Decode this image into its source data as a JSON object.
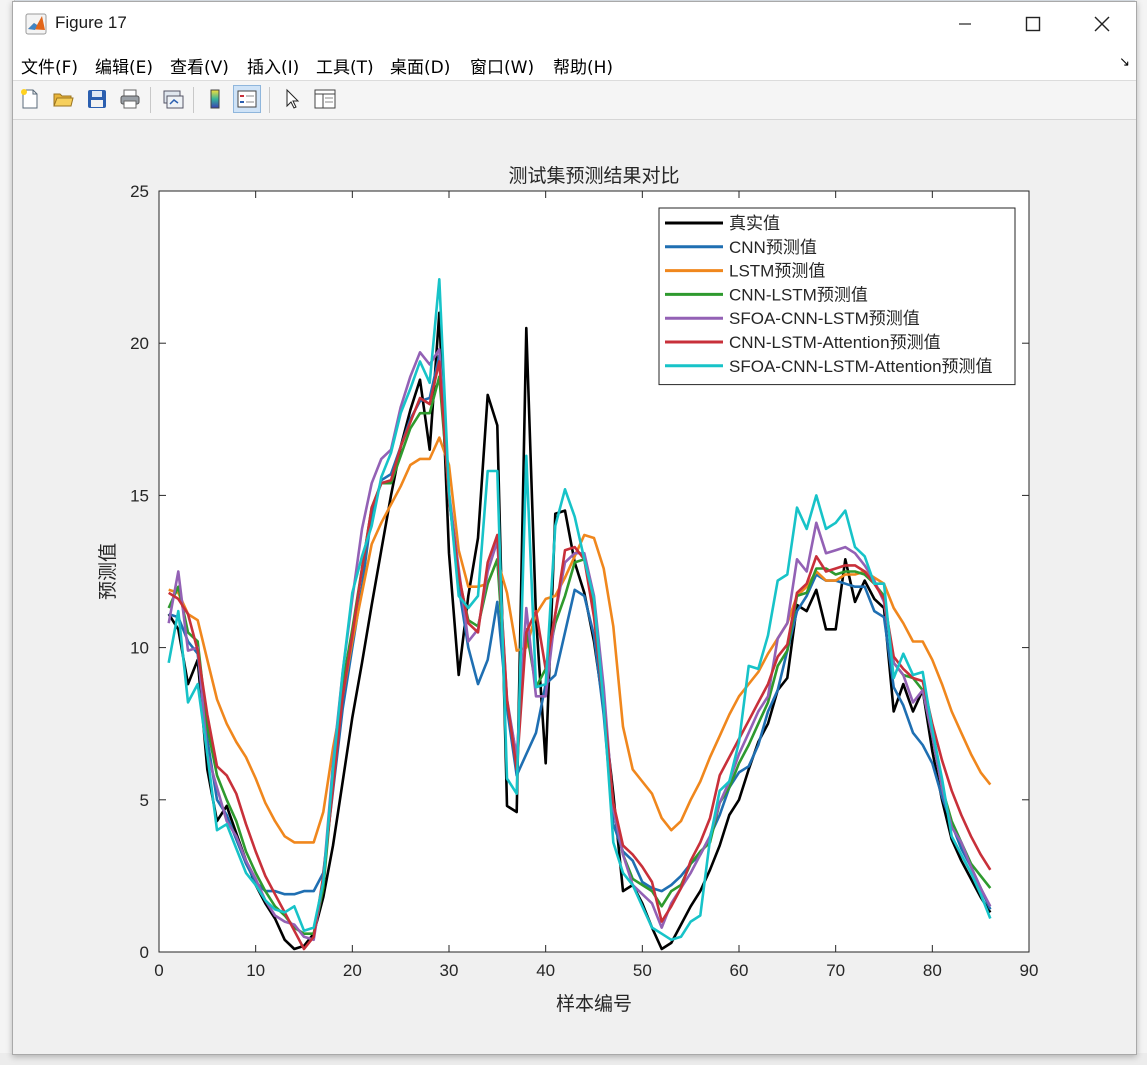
{
  "window": {
    "title": "Figure 17",
    "minimize_symbol": "—",
    "maximize_symbol": "☐",
    "close_symbol": "✕"
  },
  "menu": {
    "items": [
      "文件(F)",
      "编辑(E)",
      "查看(V)",
      "插入(I)",
      "工具(T)",
      "桌面(D)",
      "窗口(W)",
      "帮助(H)"
    ],
    "dock_arrow": "↘"
  },
  "toolbar": {
    "icons": [
      "new-figure-icon",
      "open-file-icon",
      "save-icon",
      "print-icon",
      "link-plot-icon",
      "colorbar-icon",
      "legend-icon",
      "pointer-icon",
      "property-inspector-icon"
    ]
  },
  "chart_data": {
    "type": "line",
    "title": "测试集预测结果对比",
    "xlabel": "样本编号",
    "ylabel": "预测值",
    "xlim": [
      0,
      90
    ],
    "ylim": [
      0,
      25
    ],
    "xticks": [
      0,
      10,
      20,
      30,
      40,
      50,
      60,
      70,
      80,
      90
    ],
    "yticks": [
      0,
      5,
      10,
      15,
      20,
      25
    ],
    "legend_position": "top-right",
    "grid": false,
    "x": [
      1,
      2,
      3,
      4,
      5,
      6,
      7,
      8,
      9,
      10,
      11,
      12,
      13,
      14,
      15,
      16,
      17,
      18,
      19,
      20,
      21,
      22,
      23,
      24,
      25,
      26,
      27,
      28,
      29,
      30,
      31,
      32,
      33,
      34,
      35,
      36,
      37,
      38,
      39,
      40,
      41,
      42,
      43,
      44,
      45,
      46,
      47,
      48,
      49,
      50,
      51,
      52,
      53,
      54,
      55,
      56,
      57,
      58,
      59,
      60,
      61,
      62,
      63,
      64,
      65,
      66,
      67,
      68,
      69,
      70,
      71,
      72,
      73,
      74,
      75,
      76,
      77,
      78,
      79,
      80,
      81,
      82,
      83,
      84,
      85,
      86
    ],
    "series": [
      {
        "name": "真实值",
        "color": "#000000",
        "values": [
          11.1,
          10.6,
          8.8,
          9.6,
          6.0,
          4.3,
          4.8,
          3.9,
          3.0,
          2.2,
          1.6,
          1.1,
          0.4,
          0.1,
          0.2,
          0.6,
          1.8,
          3.5,
          5.6,
          7.7,
          9.5,
          11.4,
          13.2,
          15.0,
          16.6,
          17.8,
          18.8,
          16.5,
          21.0,
          13.1,
          9.1,
          11.7,
          13.6,
          18.3,
          17.3,
          4.8,
          4.6,
          20.5,
          11.0,
          6.2,
          14.4,
          14.5,
          12.8,
          11.8,
          10.2,
          8.0,
          5.2,
          2.0,
          2.2,
          1.6,
          0.8,
          0.1,
          0.3,
          0.9,
          1.5,
          2.0,
          2.7,
          3.5,
          4.5,
          5.0,
          6.0,
          6.9,
          7.5,
          8.6,
          9.0,
          11.4,
          11.2,
          11.9,
          10.6,
          10.6,
          12.9,
          11.5,
          12.2,
          11.6,
          11.3,
          7.9,
          8.8,
          7.9,
          8.6,
          6.6,
          5.0,
          3.7,
          3.0,
          2.4,
          1.8,
          1.3
        ]
      },
      {
        "name": "CNN预测值",
        "color": "#1f6fb2",
        "values": [
          11.1,
          11.0,
          10.2,
          9.8,
          7.0,
          5.0,
          4.5,
          3.7,
          2.9,
          2.3,
          2.0,
          2.0,
          1.9,
          1.9,
          2.0,
          2.0,
          2.6,
          5.3,
          8.0,
          10.0,
          12.0,
          14.4,
          15.5,
          15.7,
          16.6,
          17.5,
          18.1,
          18.2,
          19.6,
          15.0,
          12.0,
          10.0,
          8.8,
          9.6,
          11.5,
          8.0,
          5.8,
          6.5,
          7.2,
          8.8,
          9.1,
          10.5,
          11.9,
          11.7,
          10.4,
          7.8,
          4.2,
          3.3,
          3.0,
          2.3,
          2.1,
          2.0,
          2.2,
          2.5,
          2.9,
          3.2,
          3.8,
          4.5,
          5.4,
          5.9,
          6.1,
          6.8,
          7.9,
          8.6,
          9.9,
          11.2,
          11.7,
          12.4,
          12.2,
          12.2,
          12.1,
          12.0,
          12.0,
          11.2,
          11.0,
          8.7,
          8.1,
          7.2,
          6.8,
          6.2,
          5.1,
          4.2,
          3.4,
          2.8,
          2.1,
          1.4
        ]
      },
      {
        "name": "LSTM预测值",
        "color": "#f0871d",
        "values": [
          11.9,
          11.8,
          11.1,
          10.9,
          9.6,
          8.3,
          7.5,
          6.9,
          6.4,
          5.7,
          4.9,
          4.3,
          3.8,
          3.6,
          3.6,
          3.6,
          4.6,
          6.7,
          8.4,
          10.2,
          11.8,
          13.4,
          14.1,
          14.7,
          15.3,
          16.0,
          16.2,
          16.2,
          16.9,
          16.0,
          13.2,
          12.0,
          12.0,
          12.1,
          12.9,
          11.8,
          9.9,
          10.0,
          11.1,
          11.6,
          11.7,
          12.3,
          13.0,
          13.7,
          13.6,
          12.6,
          10.7,
          7.4,
          6.0,
          5.6,
          5.2,
          4.4,
          4.0,
          4.3,
          5.0,
          5.6,
          6.4,
          7.1,
          7.8,
          8.4,
          8.8,
          9.2,
          9.8,
          10.3,
          10.8,
          11.7,
          12.0,
          12.5,
          12.2,
          12.2,
          12.4,
          12.4,
          12.5,
          12.3,
          12.1,
          11.3,
          10.8,
          10.2,
          10.2,
          9.6,
          8.8,
          7.9,
          7.2,
          6.5,
          5.9,
          5.5
        ]
      },
      {
        "name": "CNN-LSTM预测值",
        "color": "#2e9a2e",
        "values": [
          11.3,
          12.0,
          10.5,
          10.2,
          7.4,
          5.8,
          5.0,
          4.3,
          3.3,
          2.6,
          2.0,
          1.5,
          1.2,
          0.8,
          0.6,
          0.6,
          2.1,
          5.6,
          8.8,
          10.6,
          12.6,
          14.6,
          15.4,
          15.4,
          16.3,
          17.2,
          17.7,
          17.7,
          18.9,
          15.0,
          12.3,
          10.9,
          10.7,
          12.1,
          12.9,
          8.2,
          6.4,
          10.6,
          8.7,
          9.3,
          10.8,
          11.7,
          12.8,
          12.9,
          11.4,
          8.3,
          4.7,
          3.2,
          2.4,
          2.2,
          2.0,
          1.5,
          2.0,
          2.2,
          2.9,
          3.3,
          3.6,
          4.9,
          5.4,
          6.2,
          6.8,
          7.5,
          8.2,
          9.4,
          9.9,
          11.7,
          11.8,
          12.6,
          12.6,
          12.4,
          12.5,
          12.5,
          12.4,
          12.1,
          11.7,
          9.5,
          9.1,
          9.0,
          8.6,
          7.1,
          5.4,
          4.3,
          3.6,
          2.9,
          2.5,
          2.1
        ]
      },
      {
        "name": "SFOA-CNN-LSTM预测值",
        "color": "#9361b5",
        "values": [
          10.8,
          12.5,
          9.9,
          10.0,
          6.5,
          5.4,
          4.3,
          3.8,
          3.0,
          2.4,
          1.7,
          1.2,
          1.0,
          0.9,
          0.5,
          0.4,
          2.4,
          6.2,
          9.2,
          11.6,
          13.9,
          15.4,
          16.2,
          16.5,
          17.9,
          18.9,
          19.7,
          19.3,
          19.8,
          15.1,
          12.6,
          10.2,
          10.6,
          12.5,
          13.5,
          8.3,
          6.4,
          11.3,
          8.4,
          8.4,
          11.1,
          12.8,
          13.1,
          13.1,
          11.7,
          8.7,
          4.7,
          3.2,
          2.2,
          1.9,
          1.6,
          0.8,
          1.6,
          2.1,
          2.6,
          3.2,
          3.8,
          4.9,
          5.6,
          6.5,
          7.2,
          7.9,
          8.4,
          10.3,
          10.8,
          12.9,
          12.5,
          14.1,
          13.1,
          13.2,
          13.3,
          13.1,
          12.7,
          12.2,
          11.5,
          9.5,
          9.1,
          8.2,
          8.6,
          7.1,
          5.4,
          4.1,
          3.6,
          2.8,
          2.1,
          1.5
        ]
      },
      {
        "name": "CNN-LSTM-Attention预测值",
        "color": "#c8303a",
        "values": [
          11.8,
          11.6,
          11.1,
          9.9,
          7.8,
          6.1,
          5.8,
          5.2,
          4.2,
          3.3,
          2.5,
          1.9,
          1.3,
          0.7,
          0.1,
          0.5,
          2.5,
          5.4,
          8.4,
          10.4,
          12.6,
          14.6,
          15.4,
          15.5,
          16.6,
          17.4,
          18.2,
          18.0,
          19.4,
          14.9,
          12.4,
          10.8,
          10.5,
          12.8,
          13.7,
          8.3,
          6.0,
          10.5,
          11.2,
          9.3,
          11.1,
          13.2,
          13.3,
          12.9,
          11.0,
          8.1,
          4.9,
          3.5,
          3.2,
          2.8,
          2.3,
          1.0,
          1.5,
          2.1,
          3.0,
          3.6,
          4.4,
          5.8,
          6.4,
          7.0,
          7.6,
          8.2,
          8.8,
          9.7,
          10.1,
          11.8,
          12.1,
          13.0,
          12.5,
          12.6,
          12.7,
          12.7,
          12.5,
          12.1,
          11.6,
          9.7,
          9.3,
          9.0,
          8.9,
          7.5,
          6.3,
          5.3,
          4.5,
          3.8,
          3.2,
          2.7
        ]
      },
      {
        "name": "SFOA-CNN-LSTM-Attention预测值",
        "color": "#17c3c8",
        "values": [
          9.5,
          11.2,
          8.2,
          8.8,
          6.5,
          4.0,
          4.2,
          3.4,
          2.6,
          2.2,
          1.7,
          1.4,
          1.3,
          1.5,
          0.7,
          0.8,
          2.3,
          6.0,
          9.2,
          11.8,
          13.0,
          14.0,
          15.6,
          16.4,
          17.7,
          18.5,
          19.4,
          18.7,
          22.1,
          15.1,
          11.7,
          11.3,
          11.7,
          15.8,
          15.8,
          5.7,
          5.2,
          16.3,
          8.7,
          8.8,
          14.0,
          15.2,
          14.3,
          12.9,
          11.6,
          8.1,
          3.6,
          2.6,
          2.2,
          1.5,
          0.8,
          0.6,
          0.4,
          0.5,
          1.0,
          1.2,
          3.7,
          5.3,
          5.6,
          6.9,
          9.4,
          9.3,
          10.4,
          12.2,
          12.4,
          14.6,
          13.9,
          15.0,
          13.9,
          14.1,
          14.5,
          13.3,
          13.0,
          12.1,
          12.1,
          9.0,
          9.8,
          9.1,
          9.2,
          7.3,
          5.7,
          3.8,
          3.2,
          2.6,
          1.9,
          1.1
        ]
      }
    ]
  }
}
